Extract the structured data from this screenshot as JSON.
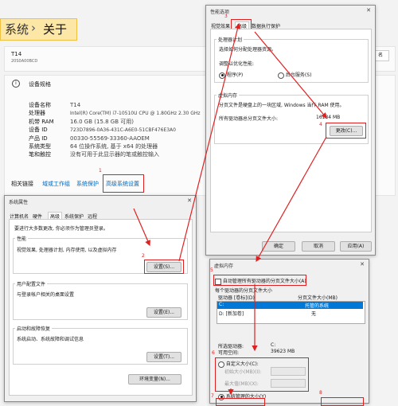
{
  "settings": {
    "breadcrumb_parent": "系统",
    "breadcrumb_sep": "›",
    "breadcrumb_current": "关于",
    "device_name": "T14",
    "device_model": "20S0A00BCD",
    "rename_label": "名",
    "specs_title": "设备规格",
    "specs": [
      {
        "label": "设备名称",
        "value": "T14"
      },
      {
        "label": "处理器",
        "value": "Intel(R) Core(TM) i7-10510U CPU @ 1.80GHz   2.30 GHz"
      },
      {
        "label": "机带 RAM",
        "value": "16.0 GB (15.8 GB 可用)"
      },
      {
        "label": "设备 ID",
        "value": "723D7896-0A36-431C-A6E0-51CBF476E3A0"
      },
      {
        "label": "产品 ID",
        "value": "00330-55569-33360-AAOEM"
      },
      {
        "label": "系统类型",
        "value": "64 位操作系统, 基于 x64 的处理器"
      },
      {
        "label": "笔和触控",
        "value": "没有可用于此显示器的笔或触控输入"
      }
    ],
    "related_label": "相关链接",
    "related_links": [
      "域或工作组",
      "系统保护",
      "高级系统设置"
    ]
  },
  "sysprops": {
    "title": "系统属性",
    "tabs": [
      "计算机名",
      "硬件",
      "高级",
      "系统保护",
      "远程"
    ],
    "admin_note": "要进行大多数更改, 你必须作为管理员登录。",
    "perf_group": "性能",
    "perf_desc": "视觉效果, 处理器计划, 内存使用, 以及虚拟内存",
    "settings_btn": "设置(S)...",
    "profile_group": "用户配置文件",
    "profile_desc": "与登录帐户相关的桌面设置",
    "settings_btn_e": "设置(E)...",
    "startup_group": "启动和故障恢复",
    "startup_desc": "系统启动、系统故障和调试信息",
    "settings_btn_t": "设置(T)...",
    "env_btn": "环境变量(N)..."
  },
  "perfopts": {
    "title": "性能选项",
    "tabs": [
      "视觉效果",
      "高级",
      "数据执行保护"
    ],
    "sched_group": "处理器计划",
    "sched_desc": "选择如何分配处理器资源。",
    "optimize_label": "调整以优化性能:",
    "opt_programs": "程序(P)",
    "opt_services": "后台服务(S)",
    "vm_group": "虚拟内存",
    "vm_desc": "分页文件是硬盘上的一块区域, Windows 当作 RAM 使用。",
    "vm_total_label": "所有驱动器总分页文件大小:",
    "vm_total_value": "16134 MB",
    "change_btn": "更改(C)...",
    "ok_btn": "确定",
    "cancel_btn": "取消",
    "apply_btn": "应用(A)"
  },
  "vmem": {
    "title": "虚拟内存",
    "auto_manage": "自动管理所有驱动器的分页文件大小(A)",
    "per_drive": "每个驱动器的分页文件大小",
    "col_drive": "驱动器 [卷标](D)",
    "col_size": "分页文件大小(MB)",
    "drives": [
      {
        "drive": "C:",
        "size": "托管的系统"
      },
      {
        "drive": "D:     [新加卷]",
        "size": "无"
      }
    ],
    "selected_label": "所选驱动器:",
    "selected_value": "C:",
    "space_label": "可用空间:",
    "space_value": "39623 MB",
    "custom_size": "自定义大小(C):",
    "initial_size": "初始大小(MB)(I):",
    "max_size": "最大值(MB)(X):",
    "system_managed": "系统管理的大小(Y)"
  },
  "annotations": [
    "1",
    "2",
    "3",
    "4",
    "5",
    "6",
    "7",
    "8"
  ],
  "colors": {
    "annotation": "#e02020",
    "highlight": "#f6c343",
    "link": "#0067c0"
  }
}
